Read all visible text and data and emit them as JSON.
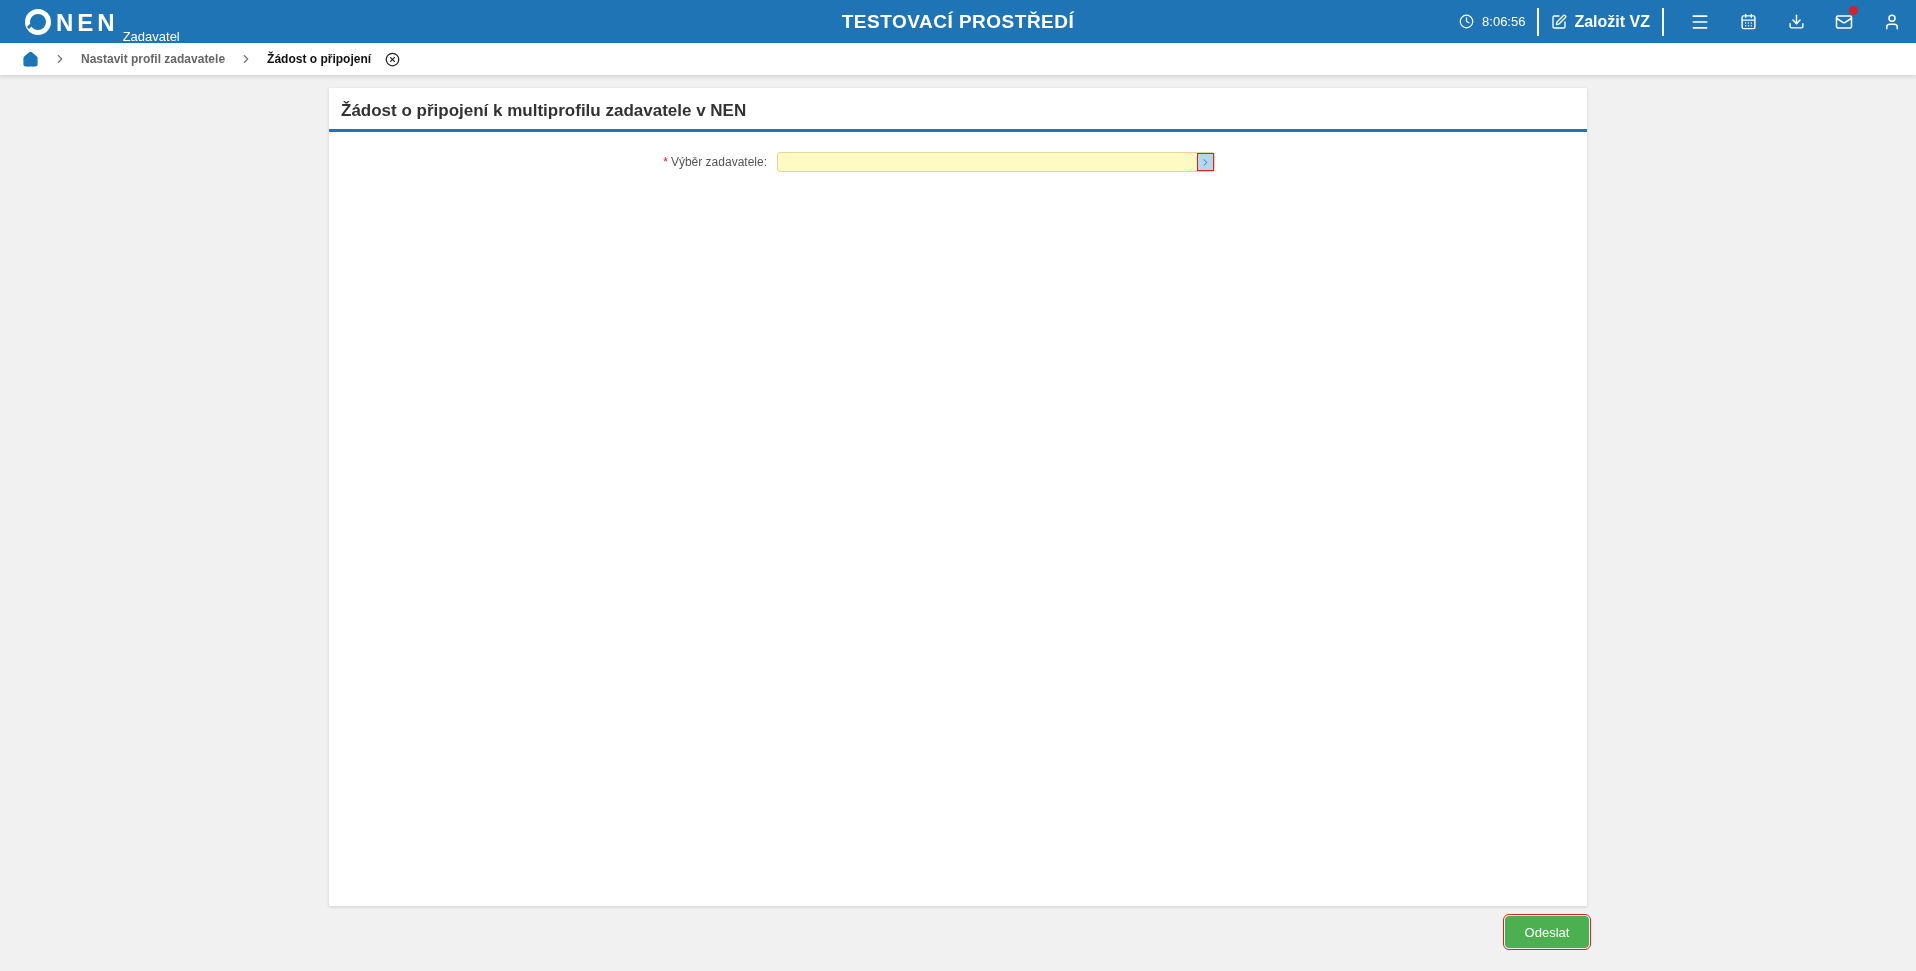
{
  "header": {
    "logo_text": "NEN",
    "logo_subtitle": "Zadavatel",
    "environment": "TESTOVACÍ PROSTŘEDÍ",
    "time": "8:06:56",
    "create_button": "Založit VZ",
    "mail_unread": true
  },
  "breadcrumbs": [
    {
      "label": "Nastavit profil zadavatele",
      "current": false
    },
    {
      "label": "Žádost o připojení",
      "current": true
    }
  ],
  "form": {
    "title": "Žádost o připojení k multiprofilu zadavatele v NEN",
    "fields": [
      {
        "label": "Výběr zadavatele",
        "required": true,
        "required_mark": "*",
        "separator": ":",
        "kind": "picker"
      }
    ]
  },
  "submit_button": "Odeslat"
}
